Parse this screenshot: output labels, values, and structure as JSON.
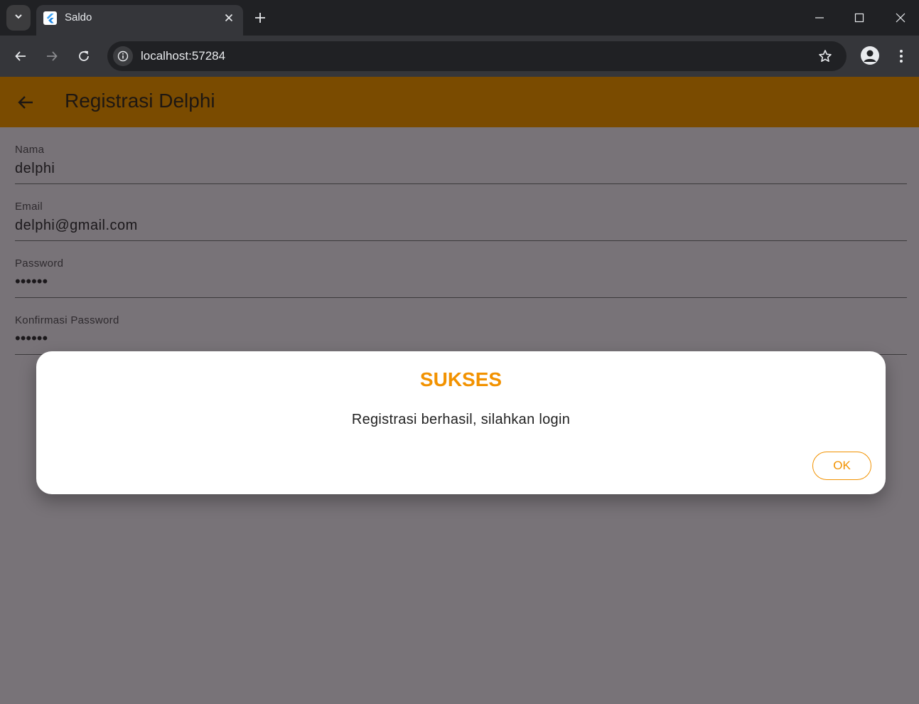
{
  "browser": {
    "tab_title": "Saldo",
    "url": "localhost:57284"
  },
  "app": {
    "title": "Registrasi Delphi"
  },
  "form": {
    "fields": [
      {
        "label": "Nama",
        "value": "delphi"
      },
      {
        "label": "Email",
        "value": "delphi@gmail.com"
      },
      {
        "label": "Password",
        "value": "••••••"
      },
      {
        "label": "Konfirmasi Password",
        "value": "••••••"
      }
    ]
  },
  "dialog": {
    "title": "SUKSES",
    "message": "Registrasi berhasil, silahkan login",
    "ok_label": "OK"
  },
  "colors": {
    "appbar": "#7a4b00",
    "accent": "#f29200",
    "scrim_background": "#787378"
  },
  "icons": {
    "tab_search": "chevron-down-icon",
    "favicon": "flutter-icon",
    "tab_close": "close-icon",
    "new_tab": "plus-icon",
    "back": "arrow-left-icon",
    "forward": "arrow-right-icon",
    "reload": "reload-icon",
    "site_info": "info-icon",
    "bookmark": "star-icon",
    "profile": "person-icon",
    "menu": "kebab-menu-icon"
  }
}
